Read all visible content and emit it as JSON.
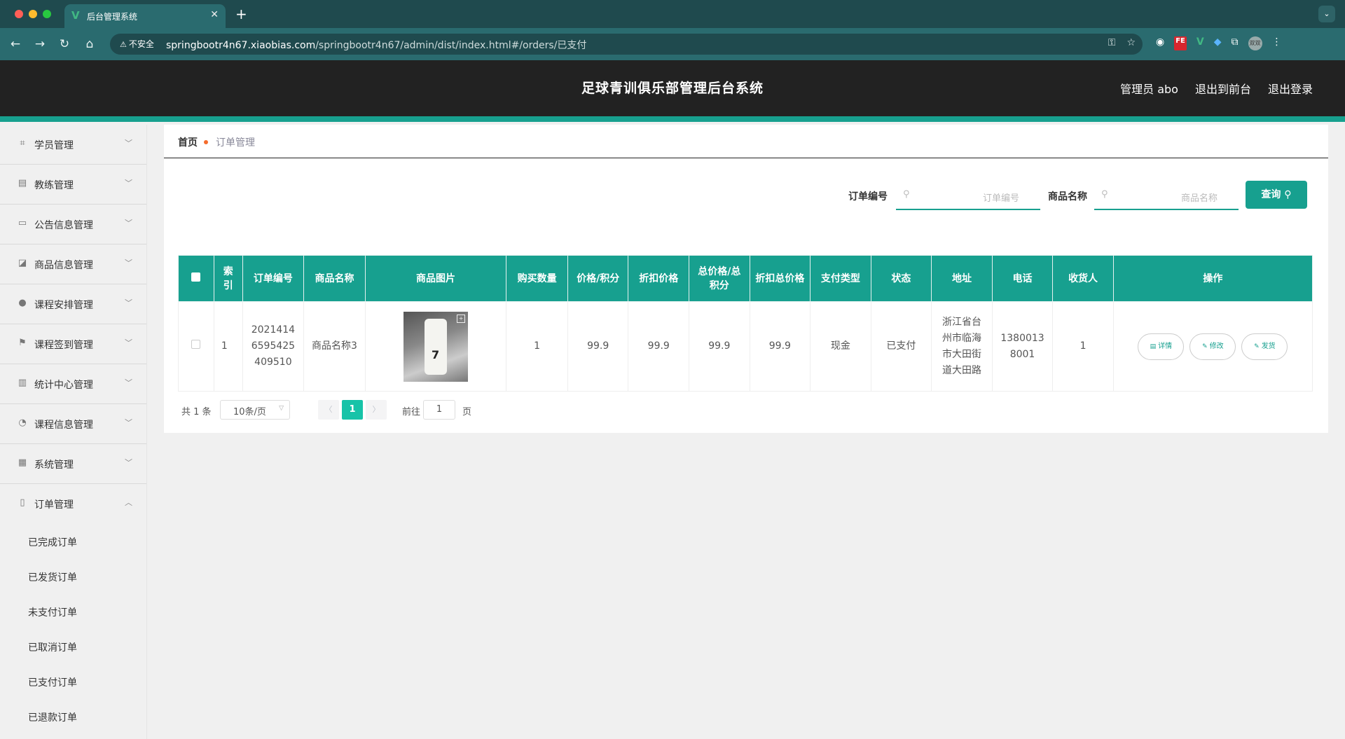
{
  "browser": {
    "tab_title": "后台管理系统",
    "new_tab": "+",
    "insecure_label": "不安全",
    "url_host": "springbootr4n67.xiaobias.com",
    "url_path": "/springbootr4n67/admin/dist/index.html#/orders/已支付",
    "profile_label": "双双"
  },
  "header": {
    "title": "足球青训俱乐部管理后台系统",
    "user": "管理员 abo",
    "to_front": "退出到前台",
    "logout": "退出登录"
  },
  "sidebar": {
    "items": [
      {
        "label": "学员管理",
        "icon": "crop-icon"
      },
      {
        "label": "教练管理",
        "icon": "briefcase-icon"
      },
      {
        "label": "公告信息管理",
        "icon": "card-icon"
      },
      {
        "label": "商品信息管理",
        "icon": "chart-icon"
      },
      {
        "label": "课程安排管理",
        "icon": "user-icon"
      },
      {
        "label": "课程签到管理",
        "icon": "flag-icon"
      },
      {
        "label": "统计中心管理",
        "icon": "bar-chart-icon"
      },
      {
        "label": "课程信息管理",
        "icon": "gauge-icon"
      },
      {
        "label": "系统管理",
        "icon": "clipboard-icon"
      },
      {
        "label": "订单管理",
        "icon": "mic-icon"
      }
    ],
    "submenu": [
      "已完成订单",
      "已发货订单",
      "未支付订单",
      "已取消订单",
      "已支付订单",
      "已退款订单"
    ]
  },
  "breadcrumb": {
    "home": "首页",
    "current": "订单管理"
  },
  "search": {
    "order_no_label": "订单编号",
    "order_no_placeholder": "订单编号",
    "product_label": "商品名称",
    "product_placeholder": "商品名称",
    "query_button": "查询"
  },
  "table": {
    "headers": [
      "索引",
      "订单编号",
      "商品名称",
      "商品图片",
      "购买数量",
      "价格/积分",
      "折扣价格",
      "总价格/总积分",
      "折扣总价格",
      "支付类型",
      "状态",
      "地址",
      "电话",
      "收货人",
      "操作"
    ],
    "rows": [
      {
        "index": "1",
        "order_no": "20214146595425409510",
        "product_name": "商品名称3",
        "quantity": "1",
        "price": "99.9",
        "discount_price": "99.9",
        "total_price": "99.9",
        "discount_total": "99.9",
        "pay_type": "现金",
        "status": "已支付",
        "address": "浙江省台州市临海市大田街道大田路",
        "phone": "13800138001",
        "receiver": "1",
        "actions": {
          "detail": "详情",
          "edit": "修改",
          "ship": "发货"
        }
      }
    ]
  },
  "pagination": {
    "total": "共 1 条",
    "page_size": "10条/页",
    "current_page": "1",
    "goto_label": "前往",
    "goto_value": "1",
    "page_suffix": "页"
  }
}
